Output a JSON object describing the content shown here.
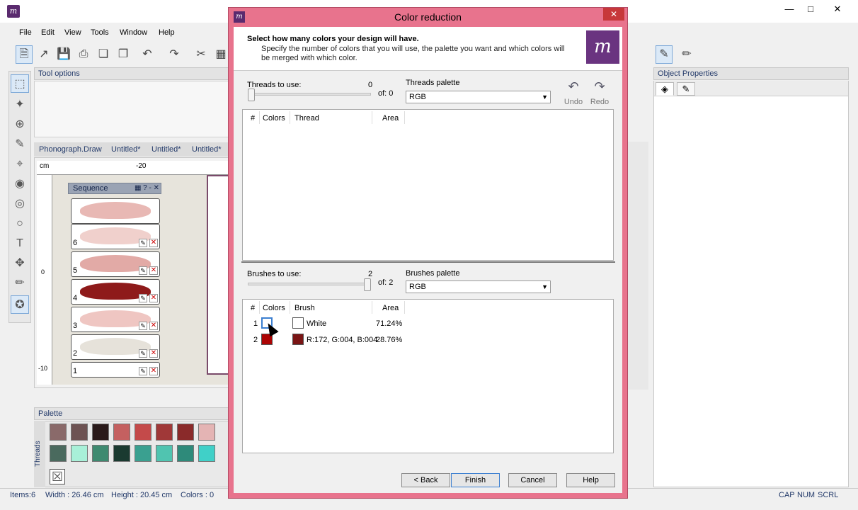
{
  "menubar": [
    "File",
    "Edit",
    "View",
    "Tools",
    "Window",
    "Help"
  ],
  "panels": {
    "tool_options": "Tool options",
    "object_properties": "Object Properties",
    "palette": "Palette",
    "threads_tab": "Threads",
    "sequence": "Sequence"
  },
  "doc_tabs": [
    "Phonograph.Draw",
    "Untitled*",
    "Untitled*",
    "Untitled*"
  ],
  "ruler": {
    "unit": "cm",
    "top_tick": "-20",
    "left_tick_0": "0",
    "left_tick_10": "-10"
  },
  "sequence_items": [
    "6",
    "5",
    "4",
    "3",
    "2",
    "1"
  ],
  "status": {
    "items": "Items:6",
    "width": "Width : 26.46 cm",
    "height": "Height : 20.45 cm",
    "colors": "Colors : 0",
    "cap": "CAP",
    "num": "NUM",
    "scrl": "SCRL"
  },
  "dialog": {
    "title": "Color reduction",
    "heading": "Select how many colors your design will have.",
    "description": "Specify the number of colors that you will use, the palette you want and which colors will be merged with which color.",
    "threads": {
      "label": "Threads to use:",
      "value": "0",
      "of": "of: 0",
      "palette_label": "Threads palette",
      "palette_value": "RGB",
      "slider_fraction": 0,
      "columns": [
        "#",
        "Colors",
        "Thread",
        "Area"
      ]
    },
    "undo": "Undo",
    "redo": "Redo",
    "brushes": {
      "label": "Brushes to use:",
      "value": "2",
      "of": "of: 2",
      "palette_label": "Brushes palette",
      "palette_value": "RGB",
      "slider_fraction": 1,
      "columns": [
        "#",
        "Colors",
        "Brush",
        "Area"
      ],
      "rows": [
        {
          "num": "1",
          "color": "#ffffff",
          "brush_color": "#ffffff",
          "brush": "White",
          "area": "71.24%"
        },
        {
          "num": "2",
          "color": "#ac0404",
          "brush_color": "#7a1515",
          "brush": "R:172, G:004, B:004",
          "area": "28.76%"
        }
      ]
    },
    "buttons": {
      "back": "< Back",
      "finish": "Finish",
      "cancel": "Cancel",
      "help": "Help"
    }
  },
  "colors": {
    "dialog_border": "#e8738d",
    "accent": "#5a2a6e"
  }
}
